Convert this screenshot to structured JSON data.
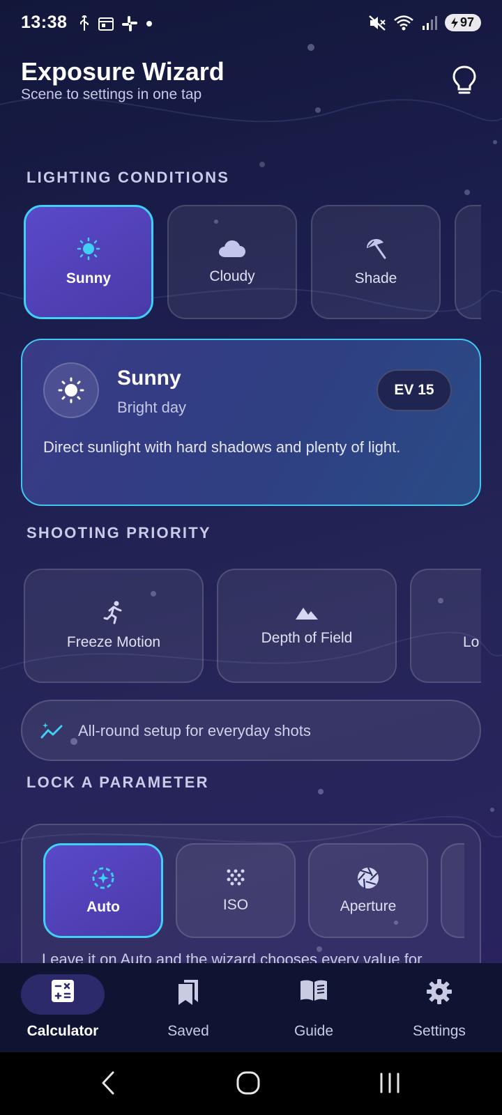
{
  "status_bar": {
    "time": "13:38",
    "battery": "97"
  },
  "header": {
    "title": "Exposure Wizard",
    "subtitle": "Scene to settings in one tap"
  },
  "lighting": {
    "section_label": "LIGHTING CONDITIONS",
    "options": [
      {
        "label": "Sunny",
        "icon": "sun-icon",
        "selected": true
      },
      {
        "label": "Cloudy",
        "icon": "cloud-icon",
        "selected": false
      },
      {
        "label": "Shade",
        "icon": "umbrella-icon",
        "selected": false
      }
    ]
  },
  "condition_card": {
    "name": "Sunny",
    "subtitle": "Bright day",
    "ev": "EV 15",
    "description": "Direct sunlight with hard shadows and plenty of light."
  },
  "priority": {
    "section_label": "SHOOTING PRIORITY",
    "options": [
      {
        "label": "Freeze Motion",
        "icon": "running-person-icon"
      },
      {
        "label": "Depth of Field",
        "icon": "mountains-icon"
      },
      {
        "label": "Lo",
        "icon": "low-light-icon"
      }
    ],
    "hint": "All-round setup for everyday shots"
  },
  "lock": {
    "section_label": "LOCK A PARAMETER",
    "options": [
      {
        "label": "Auto",
        "icon": "auto-sparkle-icon",
        "selected": true
      },
      {
        "label": "ISO",
        "icon": "iso-dots-icon",
        "selected": false
      },
      {
        "label": "Aperture",
        "icon": "aperture-icon",
        "selected": false
      }
    ],
    "description": "Leave it on Auto and the wizard chooses every value for"
  },
  "nav": {
    "items": [
      {
        "label": "Calculator",
        "icon": "calculator-icon",
        "active": true
      },
      {
        "label": "Saved",
        "icon": "bookmarks-icon",
        "active": false
      },
      {
        "label": "Guide",
        "icon": "book-icon",
        "active": false
      },
      {
        "label": "Settings",
        "icon": "gear-icon",
        "active": false
      }
    ]
  },
  "colors": {
    "accent": "#3fd0f5",
    "selected_tile": "#5a49c9",
    "background": "#1c1f4e",
    "nav_background": "#0f1433"
  }
}
